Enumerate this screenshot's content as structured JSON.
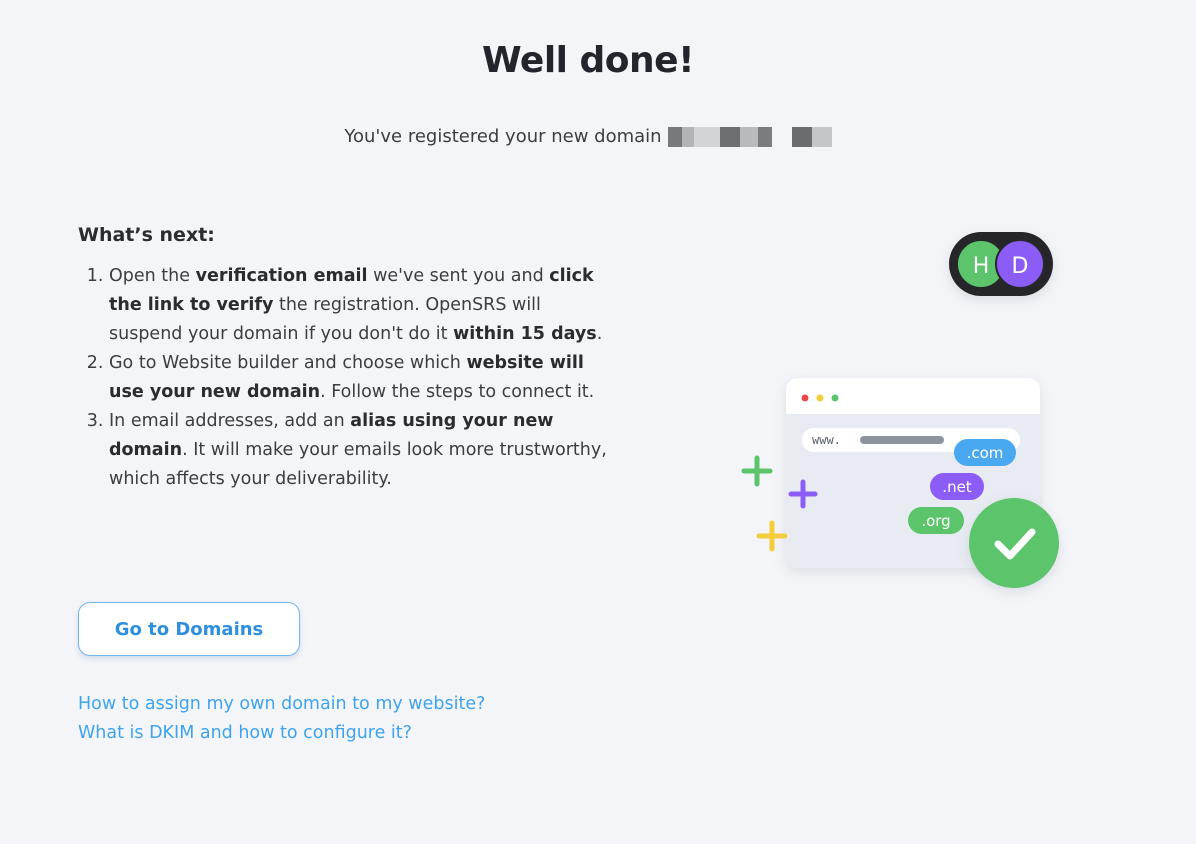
{
  "header": {
    "title": "Well done!",
    "subtitle": "You've registered your new domain"
  },
  "next": {
    "heading": "What’s next:",
    "steps": [
      {
        "t1": "Open the ",
        "b1": "verification email",
        "t2": " we've sent you and ",
        "b2": "click the link to verify",
        "t3": " the registration. OpenSRS will suspend your domain if you don't do it ",
        "b3": "within 15 days",
        "t4": "."
      },
      {
        "t1": "Go to Website builder and choose which ",
        "b1": "website will use your new domain",
        "t2": ". Follow the steps to connect it."
      },
      {
        "t1": "In email addresses, add an ",
        "b1": "alias using your new domain",
        "t2": ". It will make your emails look more trustworthy, which affects your deliverability."
      }
    ]
  },
  "actions": {
    "go_to_domains": "Go to Domains"
  },
  "links": {
    "assign_domain": "How to assign my own domain to my website?",
    "dkim": "What is DKIM and how to configure it?"
  },
  "illustration": {
    "avatar_h": "H",
    "avatar_d": "D",
    "url_prefix": "www.",
    "tld_com": ".com",
    "tld_net": ".net",
    "tld_org": ".org",
    "colors": {
      "green": "#5cc46a",
      "purple": "#8b5cf6",
      "blue": "#4aa8f0",
      "yellow": "#f5cc3c",
      "dark": "#26282c"
    }
  }
}
